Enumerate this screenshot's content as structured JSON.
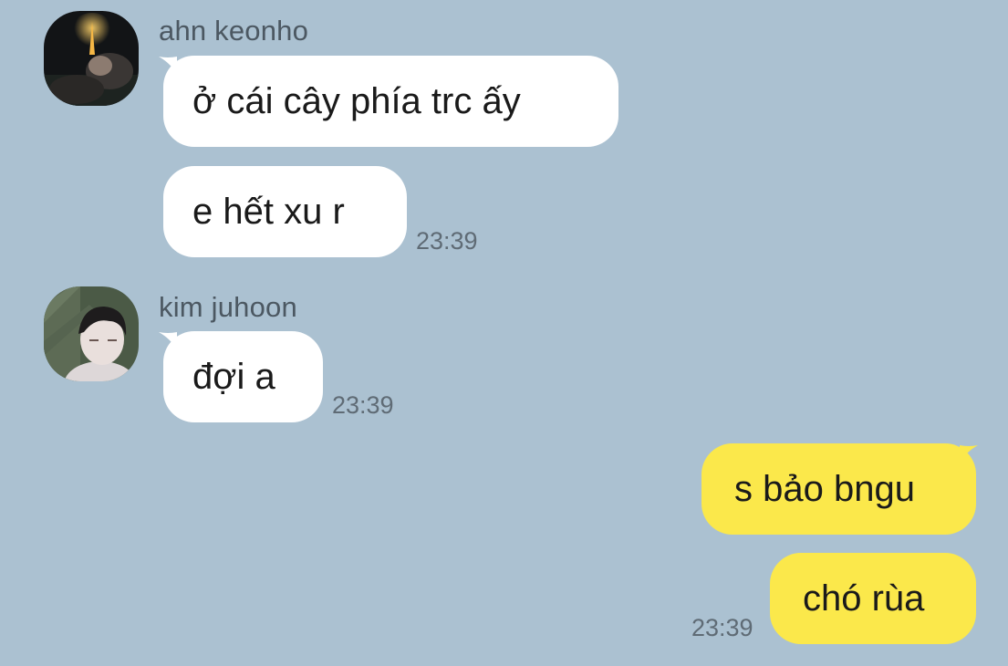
{
  "conversation": {
    "messages": [
      {
        "sender": "ahn keonho",
        "text": "ở cái cây phía trc ấy"
      },
      {
        "sender": "ahn keonho",
        "text": "e hết xu r",
        "time": "23:39"
      },
      {
        "sender": "kim juhoon",
        "text": "đợi a",
        "time": "23:39"
      },
      {
        "sender": "me",
        "text": "s bảo bngu"
      },
      {
        "sender": "me",
        "text": "chó rùa",
        "time": "23:39"
      }
    ]
  },
  "senders": {
    "first": {
      "name": "ahn keonho",
      "avatar": "profile-photo-night-sky"
    },
    "second": {
      "name": "kim juhoon",
      "avatar": "profile-photo-portrait"
    }
  },
  "colors": {
    "background": "#abc1d1",
    "incoming_bubble": "#ffffff",
    "outgoing_bubble": "#fbe84b"
  }
}
